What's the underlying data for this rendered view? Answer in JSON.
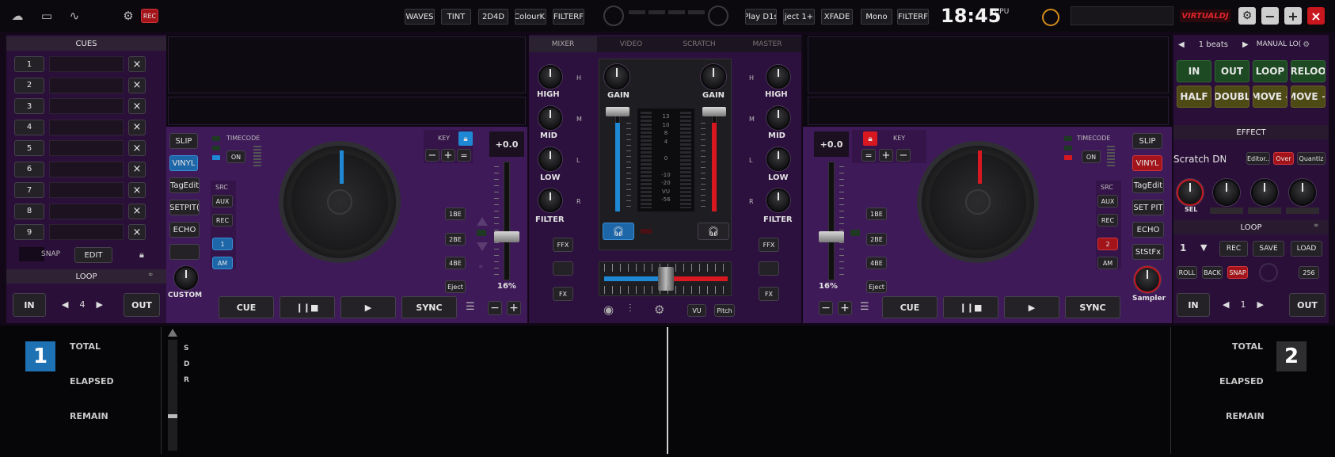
{
  "topbar": {
    "left_buttons": [
      "WAVES",
      "TINT",
      "2D4D",
      "ColourKi",
      "FILTERF"
    ],
    "right_buttons": [
      "Play D1s",
      "Eject 1+3",
      "XFADE",
      "Mono",
      "FILTERF"
    ],
    "rec_label": "REC",
    "clock": "18:45",
    "cpu_label": "CPU",
    "logo": "VIRTUALDJ",
    "minimize": "−",
    "maximize": "+",
    "close": "×"
  },
  "cues": {
    "header": "CUES",
    "rows": [
      "1",
      "2",
      "3",
      "4",
      "5",
      "6",
      "7",
      "8",
      "9"
    ],
    "delete": "×",
    "snap": "SNAP",
    "edit": "EDIT",
    "loop_header": "LOOP",
    "in": "IN",
    "out": "OUT",
    "loop_value": "4",
    "prev": "◀",
    "next": "▶"
  },
  "deck1": {
    "slip": "SLIP",
    "vinyl": "VINYL",
    "tagedit": "TagEdit",
    "setpitch": "SETPIT(",
    "echo": "ECHO",
    "custom": "CUSTOM",
    "timecode": "TIMECODE",
    "on": "ON",
    "src": "SRC",
    "aux": "AUX",
    "rec": "REC",
    "one": "1",
    "am": "AM",
    "key": "KEY",
    "pitch_value": "+0.0",
    "pitch_percent": "16%",
    "beat_buttons": [
      "1BE",
      "2BE",
      "4BE",
      "Eject"
    ],
    "cue": "CUE",
    "play_pause": "❙❙■",
    "play": "▶",
    "sync": "SYNC"
  },
  "deck2": {
    "slip": "SLIP",
    "vinyl": "VINYL",
    "tagedit": "TagEdit",
    "setpitch": "SET PIT",
    "echo": "ECHO",
    "ststfx": "StStFx",
    "sampler": "Sampler",
    "timecode": "TIMECODE",
    "on": "ON",
    "src": "SRC",
    "aux": "AUX",
    "rec": "REC",
    "two": "2",
    "am": "AM",
    "key": "KEY",
    "pitch_value": "+0.0",
    "pitch_percent": "16%",
    "beat_buttons": [
      "1BE",
      "2BE",
      "4BE",
      "Eject"
    ],
    "cue": "CUE",
    "play_pause": "❙❙■",
    "play": "▶",
    "sync": "SYNC"
  },
  "mixer": {
    "tabs": [
      "MIXER",
      "VIDEO",
      "SCRATCH",
      "MASTER"
    ],
    "eq_labels": [
      "HIGH",
      "MID",
      "LOW",
      "FILTER"
    ],
    "eq_side": [
      "H",
      "M",
      "L",
      "R"
    ],
    "gain": "GAIN",
    "vu_scale": [
      "13",
      "10",
      "8",
      "4",
      "",
      "0",
      "",
      "-10",
      "-20",
      "VU",
      "-56"
    ],
    "ffx": "FFX",
    "fx": "FX",
    "vu": "VU",
    "pitch": "Pitch"
  },
  "loopfx": {
    "beats": "1 beats",
    "manual": "MANUAL LO(",
    "row1": [
      "IN",
      "OUT",
      "LOOP",
      "RELOO"
    ],
    "row2": [
      "HALF",
      "DOUBL",
      "MOVE -",
      "MOVE +"
    ],
    "effect_header": "EFFECT",
    "effect_name": "Scratch DNA",
    "editor": "Editor..",
    "over": "Over",
    "quantize": "Quantiz",
    "sel": "SEL",
    "loop_header": "LOOP",
    "loop_num": "1",
    "rec": "REC",
    "save": "SAVE",
    "load": "LOAD",
    "roll": "ROLL",
    "back": "BACK",
    "snap": "SNAP",
    "value256": "256",
    "in": "IN",
    "out": "OUT",
    "loop_value": "1",
    "prev": "◀",
    "next": "▶"
  },
  "bottom": {
    "deck1_number": "1",
    "deck2_number": "2",
    "total": "TOTAL",
    "elapsed": "ELAPSED",
    "remain": "REMAIN",
    "sdr": [
      "S",
      "D",
      "R"
    ]
  },
  "colors": {
    "deck1": "#1e88d4",
    "deck2": "#d81820",
    "panel": "#3e1a58"
  }
}
